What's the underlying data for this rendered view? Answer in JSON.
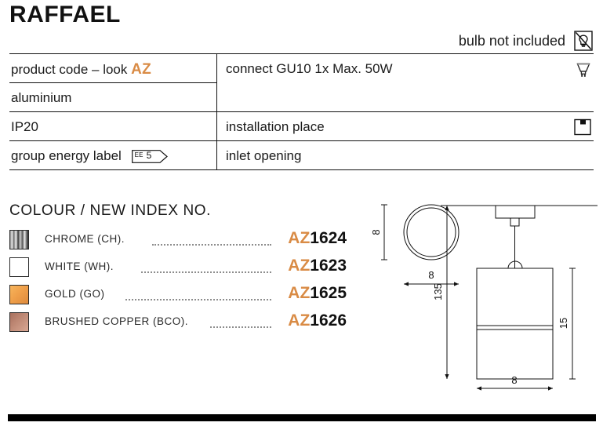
{
  "header": {
    "title": "RAFFAEL",
    "bulb_note": "bulb not included",
    "bulb_icon": "bulb-not-included-icon"
  },
  "spec_table": {
    "rows": [
      {
        "left_label": "product code – look",
        "left_accent": "AZ",
        "right_label": "connect GU10 1x Max. 50W",
        "right_icon": "gu10-lamp-icon"
      },
      {
        "left_label": "aluminium",
        "right_label": "",
        "right_icon": ""
      },
      {
        "left_label": "IP20",
        "right_label": "installation place",
        "right_icon": "ceiling-mount-icon"
      },
      {
        "left_label": "group energy label",
        "badge": {
          "prefix": "EE",
          "value": "5"
        },
        "right_label": "inlet opening",
        "right_icon": ""
      }
    ]
  },
  "colour_section": {
    "heading": "COLOUR / NEW INDEX NO.",
    "items": [
      {
        "swatch": "chrome-swatch",
        "name": "CHROME (CH).",
        "prefix": "AZ",
        "number": "1624"
      },
      {
        "swatch": "white-swatch",
        "name": "WHITE (WH).",
        "prefix": "AZ",
        "number": "1623"
      },
      {
        "swatch": "gold-swatch",
        "name": "GOLD (GO)",
        "prefix": "AZ",
        "number": "1625"
      },
      {
        "swatch": "copper-swatch",
        "name": "BRUSHED COPPER (BCO).",
        "prefix": "AZ",
        "number": "1626"
      }
    ]
  },
  "drawing": {
    "top_view": {
      "height_dim": "8",
      "width_dim": "8"
    },
    "side_view": {
      "total_height_dim": "135",
      "body_height_dim": "15",
      "width_dim": "8"
    }
  },
  "colors": {
    "accent_orange": "#d98b45",
    "line_black": "#111111",
    "text": "#1a1a1a"
  }
}
